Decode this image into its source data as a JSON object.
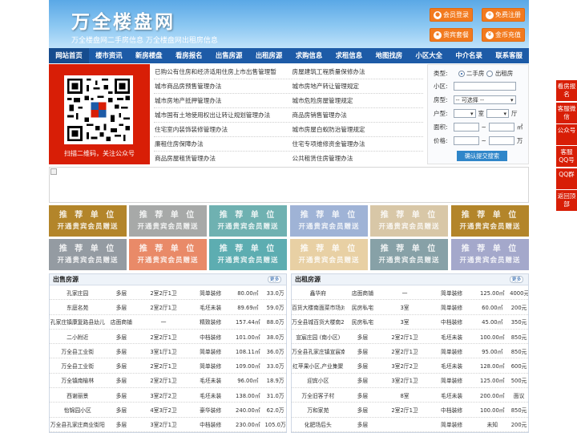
{
  "header": {
    "title": "万全楼盘网",
    "slogan": "万全楼盘网二手房信息  万全楼盘网出租房信息",
    "buttons": [
      {
        "label": "会员登录",
        "icon": "user-icon"
      },
      {
        "label": "免费注册",
        "icon": "register-icon"
      },
      {
        "label": "贵宾套餐",
        "icon": "vip-icon"
      },
      {
        "label": "金币充值",
        "icon": "coin-icon"
      }
    ]
  },
  "nav": [
    "网站首页",
    "楼市资讯",
    "新房楼盘",
    "看房报名",
    "出售房源",
    "出租房源",
    "求购信息",
    "求租信息",
    "地图找房",
    "小区大全",
    "中介名录",
    "联系客服"
  ],
  "qr": {
    "caption": "扫描二维码，关注公众号"
  },
  "policies": [
    [
      "已购公有住房和经济适用住房上市出售管理暂",
      "房屋建筑工程质量保修办法"
    ],
    [
      "城市商品房预售管理办法",
      "城市房地产转让管理规定"
    ],
    [
      "城市房地产抵押管理办法",
      "城市危险房屋管理规定"
    ],
    [
      "城市国有土地使用权出让转让规划管理办法",
      "商品房销售管理办法"
    ],
    [
      "住宅室内装饰装修管理办法",
      "城市房屋白蚁防治管理规定"
    ],
    [
      "廉租住房保障办法",
      "住宅专项维修资金管理办法"
    ],
    [
      "商品房屋租赁管理办法",
      "公共租赁住房管理办法"
    ]
  ],
  "search": {
    "type_label": "类型:",
    "type_options": [
      "二手房",
      "出租房"
    ],
    "community_label": "小区:",
    "houseType_label": "房型:",
    "houseType_value": "-- 可选择 --",
    "layout_label": "户型:",
    "room_unit": "室",
    "hall_unit": "厅",
    "area_label": "面积:",
    "area_unit": "㎡",
    "range_sep": "~",
    "price_label": "价格:",
    "price_unit": "万",
    "submit": "确认提交搜索"
  },
  "tiles": {
    "line1": "推 荐 单 位",
    "line2": "开通贵宾会员赠送"
  },
  "colors": {
    "accent": "#1d5ba7",
    "orange": "#f27a1e",
    "red": "#d81e06",
    "tiles": [
      "#b3852a",
      "#a7a9a8",
      "#6fb1b1",
      "#9fb3d6",
      "#d8c7a7",
      "#b3852a",
      "#949ba2",
      "#e98a68",
      "#5dadb1",
      "#e8d0a4",
      "#87a1a7",
      "#a4a8cb"
    ]
  },
  "sale": {
    "title": "出售房源",
    "more": "更多",
    "rows": [
      [
        "孔家庄园",
        "多层",
        "2室2厅1卫",
        "简单装修",
        "80.00㎡",
        "33.0万"
      ],
      [
        "东庭名苑",
        "多层",
        "2室2厅1卫",
        "毛坯未装",
        "89.69㎡",
        "59.0万"
      ],
      [
        "孔家庄镇康复路县幼儿",
        "店面商铺",
        "一",
        "精致装修",
        "157.44㎡",
        "88.0万"
      ],
      [
        "二小附近",
        "多层",
        "2室2厅1卫",
        "中档装修",
        "101.00㎡",
        "38.0万"
      ],
      [
        "万全县工业街",
        "多层",
        "3室1厅1卫",
        "简单装修",
        "108.11㎡",
        "36.0万"
      ],
      [
        "万全县工业街",
        "多层",
        "2室2厅1卫",
        "简单装修",
        "109.00㎡",
        "33.0万"
      ],
      [
        "万全镇南榆林",
        "多层",
        "2室2厅1卫",
        "毛坯未装",
        "96.00㎡",
        "18.9万"
      ],
      [
        "西谢丽景",
        "多层",
        "3室2厅2卫",
        "毛坯未装",
        "138.00㎡",
        "31.0万"
      ],
      [
        "怡锦园小区",
        "多层",
        "4室3厅2卫",
        "豪华装修",
        "240.00㎡",
        "62.0万"
      ],
      [
        "万全县孔家庄商业街阳",
        "多层",
        "3室2厅1卫",
        "中档装修",
        "230.00㎡",
        "105.0万"
      ]
    ]
  },
  "rent": {
    "title": "出租房源",
    "more": "更多",
    "rows": [
      [
        "鑫华府",
        "店面商铺",
        "一",
        "简单装修",
        "125.00㎡",
        "4000元"
      ],
      [
        "百货大楼南面菜市场对",
        "民房私宅",
        "3室",
        "简单装修",
        "60.00㎡",
        "200元"
      ],
      [
        "万全县城百货大楼南2",
        "民房私宅",
        "3室",
        "中档装修",
        "45.00㎡",
        "350元"
      ],
      [
        "宣宸庄园 (南小区)",
        "多层",
        "2室2厅1卫",
        "毛坯未装",
        "100.00㎡",
        "850元"
      ],
      [
        "万全县孔家庄镇宣宸南",
        "多层",
        "2室2厅1卫",
        "简单装修",
        "95.00㎡",
        "850元"
      ],
      [
        "红苹果小区,产业集聚",
        "多层",
        "3室2厅2卫",
        "毛坯未装",
        "128.00㎡",
        "600元"
      ],
      [
        "迎宾小区",
        "多层",
        "3室2厅1卫",
        "简单装修",
        "125.00㎡",
        "500元"
      ],
      [
        "万全旧客子村",
        "多层",
        "8室",
        "毛坯未装",
        "200.00㎡",
        "面议"
      ],
      [
        "万和家苑",
        "多层",
        "2室2厅1卫",
        "中档装修",
        "100.00㎡",
        "850元"
      ],
      [
        "化肥场后头",
        "多层",
        "",
        "简单装修",
        "未知",
        "200元"
      ]
    ]
  },
  "sidebar": [
    "看房报名",
    "客服微信",
    "公众号",
    "客服QQ号",
    "QQ群",
    "返回顶部"
  ]
}
